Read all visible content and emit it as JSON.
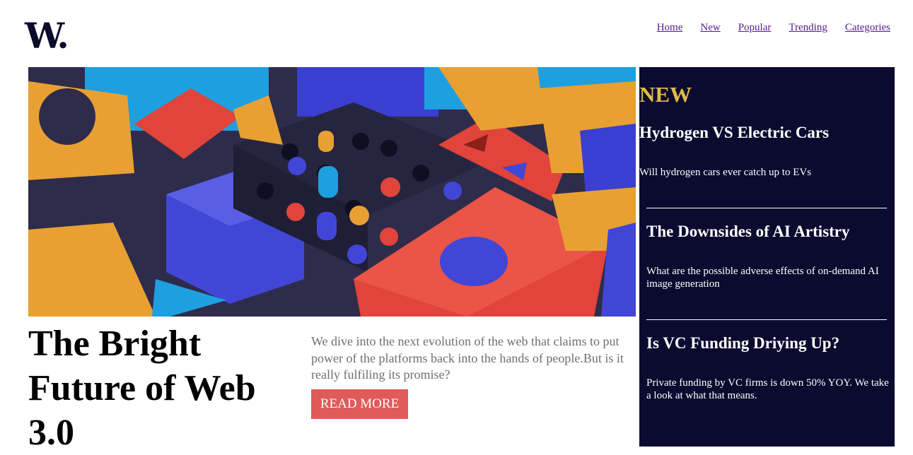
{
  "brand": {
    "logo": "W."
  },
  "nav": {
    "items": [
      "Home",
      "New",
      "Popular",
      "Trending",
      "Categories"
    ]
  },
  "hero": {
    "headline": "The Bright Future of Web 3.0",
    "lede": "We dive into the next evolution of the web that claims to put power of the platforms back into the hands of people.But is it really fulfiling its promise?",
    "cta": "READ MORE"
  },
  "sidebar": {
    "heading": "NEW",
    "stories": [
      {
        "title": "Hydrogen VS Electric Cars",
        "summary": "Will hydrogen cars ever catch up to EVs"
      },
      {
        "title": "The Downsides of AI Artistry",
        "summary": "What are the possible adverse effects of on-demand AI image generation"
      },
      {
        "title": "Is VC Funding Driying Up?",
        "summary": "Private funding by VC firms is down 50% YOY. We take a look at what that means."
      }
    ]
  },
  "colors": {
    "brand_dark": "#0b0a2f",
    "accent_gold": "#e0bb4a",
    "cta_red": "#e05a5a",
    "link": "#551a8b"
  },
  "icons": {
    "hero_image": "abstract-3d-blocks-illustration"
  }
}
